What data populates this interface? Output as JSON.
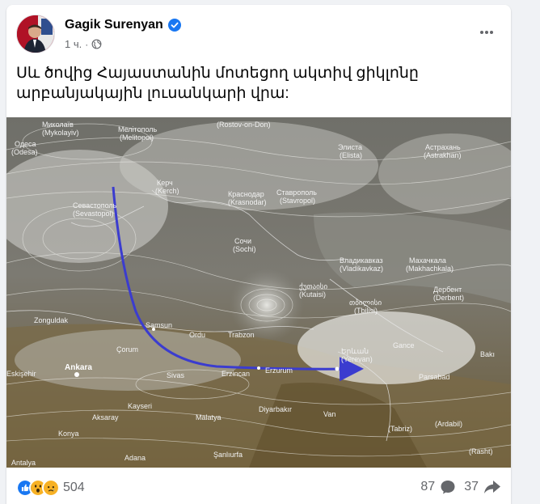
{
  "post": {
    "author": "Gagik Surenyan",
    "time": "1 ч.",
    "separator": "·",
    "text": "Սև ծովից Հայաստանին մոտեցող ակտիվ ցիկլոնը արբանյակային լուսանկարի վրա:",
    "more_icon": "more-horizontal-icon",
    "privacy_icon": "globe-icon",
    "verified_icon": "verified-badge-icon"
  },
  "map": {
    "arrow_color": "#3b3ccf",
    "labels": [
      {
        "text": "Миколаїв",
        "sub": "(Mykolayiv)"
      },
      {
        "text": "Мелітополь",
        "sub": "(Melitopol)"
      },
      {
        "text": "(Rostov-on-Don)",
        "sub": ""
      },
      {
        "text": "Элиста",
        "sub": "(Elista)"
      },
      {
        "text": "Астрахань",
        "sub": "(Astrakhan)"
      },
      {
        "text": "Одеса",
        "sub": "(Odesa)"
      },
      {
        "text": "Керч",
        "sub": "(Kerch)"
      },
      {
        "text": "Краснодар",
        "sub": "(Krasnodar)"
      },
      {
        "text": "Ставрополь",
        "sub": "(Stavropol)"
      },
      {
        "text": "Севастополь",
        "sub": "(Sevastopol)"
      },
      {
        "text": "Сочи",
        "sub": "(Sochi)"
      },
      {
        "text": "Владикавказ",
        "sub": "(Vladikavkaz)"
      },
      {
        "text": "Махачкала",
        "sub": "(Makhachkala)"
      },
      {
        "text": "ქუთაისი",
        "sub": "(Kutaisi)"
      },
      {
        "text": "თბილისი",
        "sub": "(Tbilisi)"
      },
      {
        "text": "Дербент",
        "sub": "(Derbent)"
      },
      {
        "text": "Zonguldak",
        "sub": ""
      },
      {
        "text": "Samsun",
        "sub": ""
      },
      {
        "text": "Ordu",
        "sub": ""
      },
      {
        "text": "Trabzon",
        "sub": ""
      },
      {
        "text": "Gance",
        "sub": ""
      },
      {
        "text": "Bakı",
        "sub": ""
      },
      {
        "text": "Çorum",
        "sub": ""
      },
      {
        "text": "Erzurum",
        "sub": ""
      },
      {
        "text": "Երևան",
        "sub": "(Yerevan)"
      },
      {
        "text": "Eskişehir",
        "sub": ""
      },
      {
        "text": "Ankara",
        "sub": ""
      },
      {
        "text": "Sivas",
        "sub": ""
      },
      {
        "text": "Erzincan",
        "sub": ""
      },
      {
        "text": "Parsabad",
        "sub": ""
      },
      {
        "text": "Kayseri",
        "sub": ""
      },
      {
        "text": "Aksaray",
        "sub": ""
      },
      {
        "text": "Malatya",
        "sub": ""
      },
      {
        "text": "Van",
        "sub": ""
      },
      {
        "text": "(Tabriz)",
        "sub": ""
      },
      {
        "text": "(Ardabil)",
        "sub": ""
      },
      {
        "text": "Konya",
        "sub": ""
      },
      {
        "text": "Diyarbakır",
        "sub": ""
      },
      {
        "text": "Adana",
        "sub": ""
      },
      {
        "text": "Şanlıurfa",
        "sub": ""
      },
      {
        "text": "(Rasht)",
        "sub": ""
      },
      {
        "text": "Antalya",
        "sub": ""
      }
    ]
  },
  "footer": {
    "reaction_icons": [
      "like-reaction-icon",
      "wow-reaction-icon",
      "sad-reaction-icon"
    ],
    "reaction_count": "504",
    "comment_count": "87",
    "comment_icon": "comment-icon",
    "share_count": "37",
    "share_icon": "share-icon"
  },
  "colors": {
    "like_blue": "#1877f2",
    "verified_blue": "#1877f2",
    "muted_text": "#65676b",
    "reaction_yellow": "#f7b125"
  }
}
